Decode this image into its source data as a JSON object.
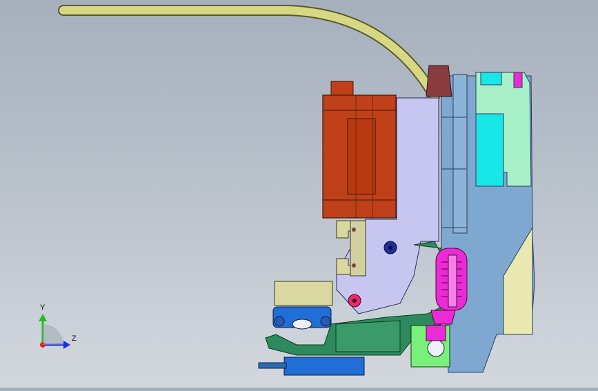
{
  "viewport": {
    "background_top": "#a6b0bd",
    "background_bottom": "#d3d8de"
  },
  "triad": {
    "y_label": "Y",
    "z_label": "Z",
    "y_color": "#1fbf1f",
    "z_color": "#1f2fe0",
    "x_color": "#e01f1f"
  },
  "model": {
    "tube_color": "#d6d884",
    "motor_color": "#c0401a",
    "frame_color": "#c6c6f0",
    "plate_color": "#7fa8d0",
    "panel_color": "#a8f0c8",
    "cyan_color": "#19e6e6",
    "bracket_color": "#d8d8a0",
    "base_color": "#2e8a5e",
    "hotend_color": "#ec2ad6",
    "carriage_color": "#1f6fd6",
    "light_green_color": "#79f07a",
    "yellow_panel_color": "#e8e8b0"
  }
}
